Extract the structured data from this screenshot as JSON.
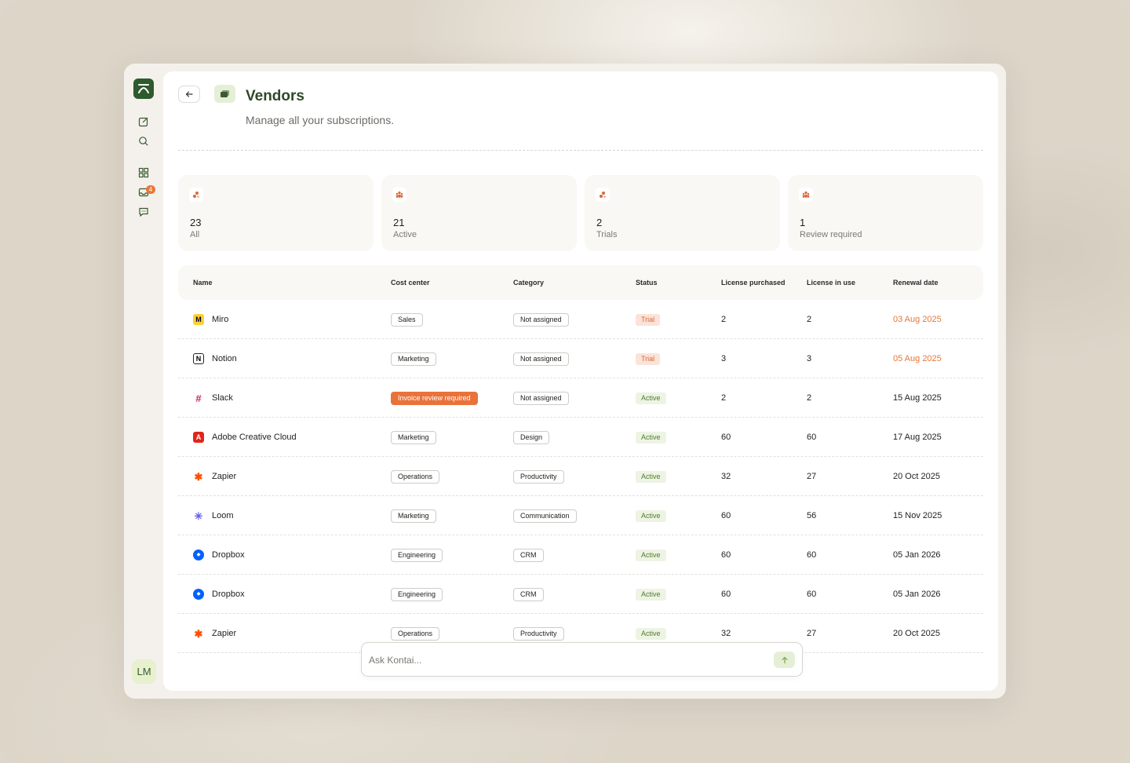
{
  "page": {
    "title": "Vendors",
    "subtitle": "Manage all your subscriptions."
  },
  "sidebar": {
    "items": [
      {
        "icon": "compose-icon"
      },
      {
        "icon": "search-icon"
      },
      {
        "icon": "dashboard-icon"
      },
      {
        "icon": "inbox-icon",
        "badge": "4"
      },
      {
        "icon": "chat-icon"
      }
    ],
    "avatar_initials": "LM"
  },
  "stats": [
    {
      "count": "23",
      "label": "All",
      "icon": "cluster-icon"
    },
    {
      "count": "21",
      "label": "Active",
      "icon": "people-icon"
    },
    {
      "count": "2",
      "label": "Trials",
      "icon": "cluster-icon"
    },
    {
      "count": "1",
      "label": "Review required",
      "icon": "people-icon"
    }
  ],
  "table": {
    "columns": [
      "Name",
      "Cost center",
      "Category",
      "Status",
      "License purchased",
      "License in use",
      "Renewal date"
    ],
    "rows": [
      {
        "name": "Miro",
        "logo": "miro-logo",
        "cost_center": "Sales",
        "category": "Not assigned",
        "status": "Trial",
        "purchased": "2",
        "in_use": "2",
        "renewal": "03 Aug 2025",
        "renewal_soon": true
      },
      {
        "name": "Notion",
        "logo": "notion-logo",
        "cost_center": "Marketing",
        "category": "Not assigned",
        "status": "Trial",
        "purchased": "3",
        "in_use": "3",
        "renewal": "05 Aug 2025",
        "renewal_soon": true
      },
      {
        "name": "Slack",
        "logo": "slack-logo",
        "cost_center": "Invoice review required",
        "cost_center_alert": true,
        "category": "Not assigned",
        "status": "Active",
        "purchased": "2",
        "in_use": "2",
        "renewal": "15 Aug 2025"
      },
      {
        "name": "Adobe Creative Cloud",
        "logo": "adobe-logo",
        "cost_center": "Marketing",
        "category": "Design",
        "status": "Active",
        "purchased": "60",
        "in_use": "60",
        "renewal": "17 Aug 2025"
      },
      {
        "name": "Zapier",
        "logo": "zapier-logo",
        "cost_center": "Operations",
        "category": "Productivity",
        "status": "Active",
        "purchased": "32",
        "in_use": "27",
        "renewal": "20 Oct 2025"
      },
      {
        "name": "Loom",
        "logo": "loom-logo",
        "cost_center": "Marketing",
        "category": "Communication",
        "status": "Active",
        "purchased": "60",
        "in_use": "56",
        "renewal": "15 Nov 2025"
      },
      {
        "name": "Dropbox",
        "logo": "dropbox-logo",
        "cost_center": "Engineering",
        "category": "CRM",
        "status": "Active",
        "purchased": "60",
        "in_use": "60",
        "renewal": "05 Jan 2026"
      },
      {
        "name": "Dropbox",
        "logo": "dropbox-logo",
        "cost_center": "Engineering",
        "category": "CRM",
        "status": "Active",
        "purchased": "60",
        "in_use": "60",
        "renewal": "05 Jan 2026"
      },
      {
        "name": "Zapier",
        "logo": "zapier-logo",
        "cost_center": "Operations",
        "category": "Productivity",
        "status": "Active",
        "purchased": "32",
        "in_use": "27",
        "renewal": "20 Oct 2025"
      }
    ]
  },
  "ask": {
    "placeholder": "Ask Kontai..."
  },
  "colors": {
    "brand_green": "#2f5a2c",
    "accent_orange": "#e9723a",
    "active_green": "#4e7a30"
  }
}
